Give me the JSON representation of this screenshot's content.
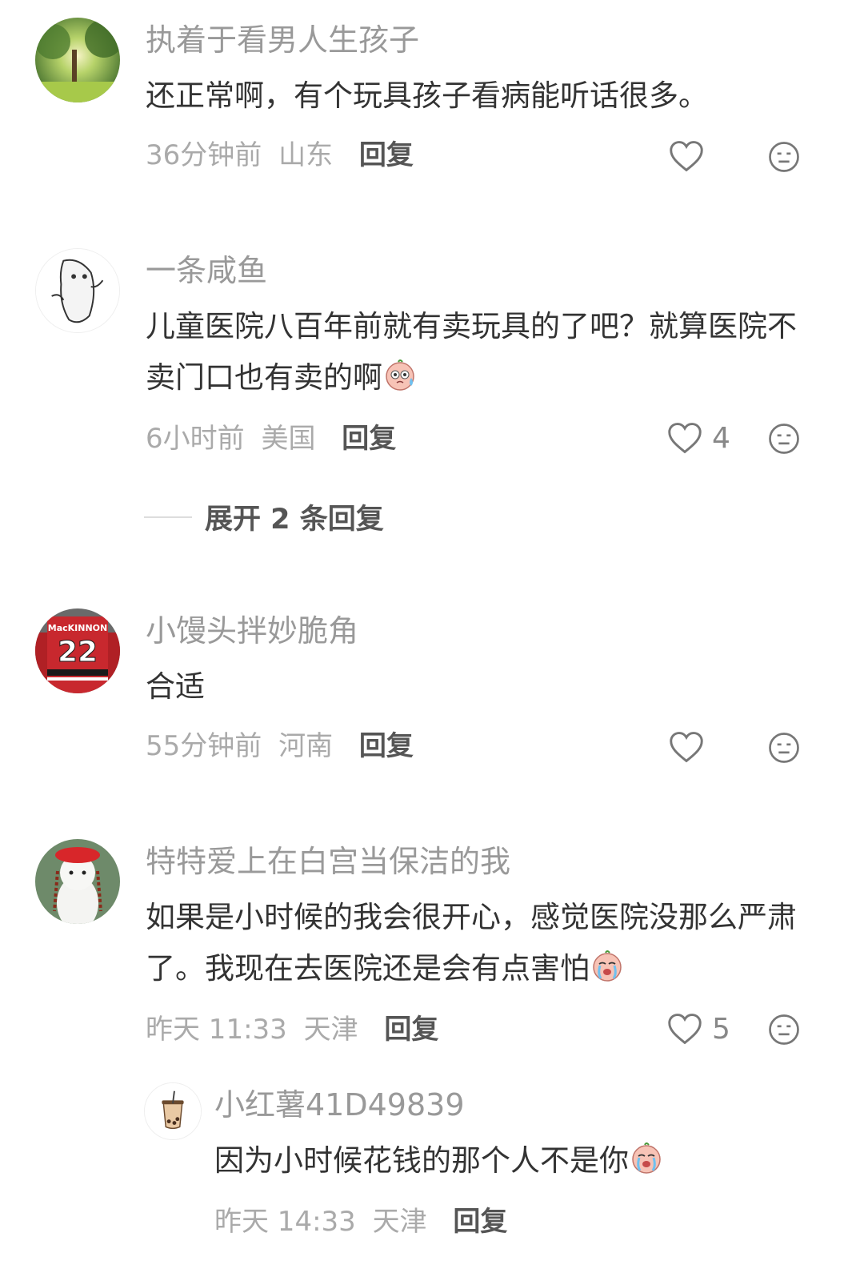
{
  "comments": [
    {
      "username": "执着于看男人生孩子",
      "text": "还正常啊，有个玩具孩子看病能听话很多。",
      "time": "36分钟前",
      "location": "山东",
      "reply_label": "回复",
      "likes": "",
      "avatar_icon": "forest-sunlight-avatar"
    },
    {
      "username": "一条咸鱼",
      "text": "儿童医院八百年前就有卖玩具的了吧？就算医院不卖门口也有卖的啊",
      "emoji": "sweat-face-emoji",
      "time": "6小时前",
      "location": "美国",
      "reply_label": "回复",
      "likes": "4",
      "avatar_icon": "salted-fish-avatar"
    },
    {
      "username": "小馒头拌妙脆角",
      "text": "合适",
      "time": "55分钟前",
      "location": "河南",
      "reply_label": "回复",
      "likes": "",
      "avatar_icon": "hockey-jersey-avatar",
      "avatar_text": "MacKINNON 22"
    },
    {
      "username": "特特爱上在白宫当保洁的我",
      "text": "如果是小时候的我会很开心，感觉医院没那么严肃了。我现在去医院还是会有点害怕",
      "emoji": "crying-face-emoji",
      "time": "昨天 11:33",
      "location": "天津",
      "reply_label": "回复",
      "likes": "5",
      "avatar_icon": "white-cat-red-hat-avatar"
    }
  ],
  "expand_replies": "展开 2 条回复",
  "sub_reply": {
    "username": "小红薯41D49839",
    "text": "因为小时候花钱的那个人不是你",
    "emoji": "crying-face-emoji",
    "time": "昨天 14:33",
    "location": "天津",
    "reply_label": "回复",
    "avatar_icon": "bubble-tea-avatar"
  },
  "colors": {
    "username": "#999999",
    "body_text": "#333333",
    "meta": "#aaaaaa",
    "reply": "#555555"
  }
}
